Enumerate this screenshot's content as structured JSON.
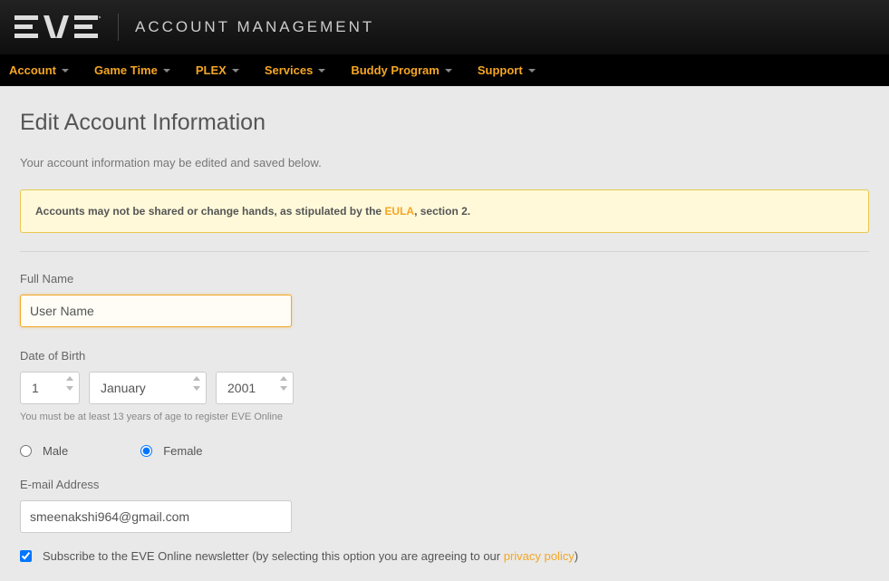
{
  "header": {
    "title": "ACCOUNT MANAGEMENT"
  },
  "nav": {
    "items": [
      {
        "label": "Account"
      },
      {
        "label": "Game Time"
      },
      {
        "label": "PLEX"
      },
      {
        "label": "Services"
      },
      {
        "label": "Buddy Program"
      },
      {
        "label": "Support"
      }
    ]
  },
  "page": {
    "title": "Edit Account Information",
    "subtitle": "Your account information may be edited and saved below."
  },
  "warning": {
    "prefix": "Accounts may not be shared or change hands, as stipulated by the ",
    "eula_label": "EULA",
    "suffix": ", section 2."
  },
  "form": {
    "fullname_label": "Full Name",
    "fullname_value": "User Name",
    "dob_label": "Date of Birth",
    "dob_day": "1",
    "dob_month": "January",
    "dob_year": "2001",
    "dob_hint": "You must be at least 13 years of age to register EVE Online",
    "gender_male": "Male",
    "gender_female": "Female",
    "gender_selected": "female",
    "email_label": "E-mail Address",
    "email_value": "smeenakshi964@gmail.com",
    "newsletter_prefix": "Subscribe to the EVE Online newsletter (by selecting this option you are agreeing to our ",
    "policy_label": "privacy policy",
    "newsletter_suffix": ")",
    "newsletter_checked": true
  }
}
